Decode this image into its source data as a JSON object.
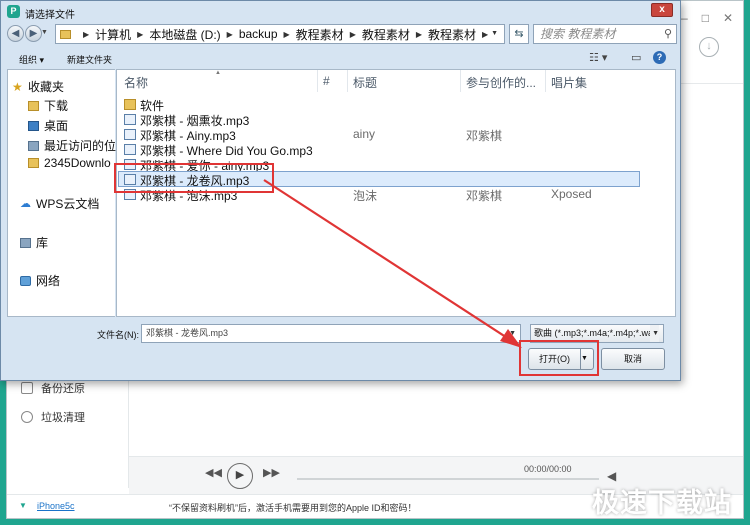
{
  "app": {
    "title_buttons": [
      "—",
      "□",
      "✕"
    ],
    "sidebar_items": [
      {
        "label": "备份还原",
        "icon": "backup-icon"
      },
      {
        "label": "垃圾清理",
        "icon": "broom-icon"
      }
    ],
    "player": {
      "prev": "◀◀",
      "play": "▶",
      "next": "▶▶",
      "time": "00:00/00:00",
      "volume": "◀"
    },
    "status": {
      "device": "iPhone5c",
      "message": "“不保留资料刷机”后，激活手机需要用到您的Apple ID和密码！"
    },
    "watermark": "极速下载站"
  },
  "dialog": {
    "title": "请选择文件",
    "close": "x",
    "address": {
      "segments": [
        "计算机",
        "本地磁盘 (D:)",
        "backup",
        "教程素材",
        "教程素材",
        "教程素材"
      ]
    },
    "search_placeholder": "搜索 教程素材",
    "toolbar": {
      "organize": "组织 ▾",
      "new_folder": "新建文件夹",
      "view": "☷ ▾",
      "pane": "▭"
    },
    "nav": [
      {
        "label": "收藏夹",
        "icon": "star-icon"
      },
      {
        "label": "下载",
        "icon": "download-folder-icon"
      },
      {
        "label": "桌面",
        "icon": "desktop-icon"
      },
      {
        "label": "最近访问的位",
        "icon": "recent-icon"
      },
      {
        "label": "2345Downlo",
        "icon": "folder-icon"
      },
      {
        "label": "WPS云文档",
        "icon": "cloud-icon"
      },
      {
        "label": "库",
        "icon": "library-icon"
      },
      {
        "label": "网络",
        "icon": "network-icon"
      }
    ],
    "columns": {
      "name": "名称",
      "number": "#",
      "title": "标题",
      "artist": "参与创作的...",
      "album": "唱片集"
    },
    "files": [
      {
        "name": "软件",
        "type": "folder",
        "title": "",
        "artist": "",
        "album": ""
      },
      {
        "name": "邓紫棋 - 烟熏妆.mp3",
        "type": "mp3",
        "title": "",
        "artist": "",
        "album": ""
      },
      {
        "name": "邓紫棋 - Ainy.mp3",
        "type": "mp3",
        "title": "ainy",
        "artist": "邓紫棋",
        "album": ""
      },
      {
        "name": "邓紫棋 - Where Did You Go.mp3",
        "type": "mp3",
        "title": "",
        "artist": "",
        "album": ""
      },
      {
        "name": "邓紫棋 - 爱你 - ainy.mp3",
        "type": "mp3",
        "title": "",
        "artist": "",
        "album": ""
      },
      {
        "name": "邓紫棋 - 龙卷风.mp3",
        "type": "mp3",
        "title": "",
        "artist": "",
        "album": "",
        "selected": true
      },
      {
        "name": "邓紫棋 - 泡沫.mp3",
        "type": "mp3",
        "title": "泡沫",
        "artist": "邓紫棋",
        "album": "Xposed"
      }
    ],
    "filename_label": "文件名(N):",
    "filename_value": "邓紫棋 - 龙卷风.mp3",
    "filetype_value": "歌曲 (*.mp3;*.m4a;*.m4p;*.wa",
    "open_label": "打开(O)",
    "cancel_label": "取消"
  },
  "colors": {
    "background": "#1fa58f",
    "highlight": "#e03535",
    "selection": "#dcebfc"
  }
}
